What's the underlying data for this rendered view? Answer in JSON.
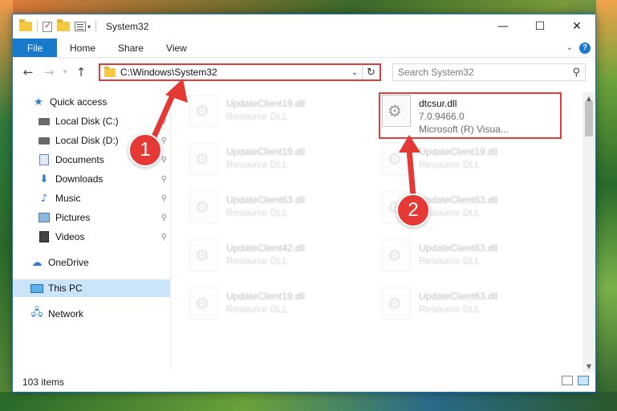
{
  "window": {
    "title": "System32",
    "controls": {
      "minimize": "—",
      "maximize": "☐",
      "close": "✕"
    }
  },
  "ribbon": {
    "tabs": [
      {
        "label": "File"
      },
      {
        "label": "Home"
      },
      {
        "label": "Share"
      },
      {
        "label": "View"
      }
    ]
  },
  "address": {
    "path": "C:\\Windows\\System32"
  },
  "search": {
    "placeholder": "Search System32"
  },
  "sidebar": {
    "items": [
      {
        "label": "Quick access",
        "icon": "star-icon"
      },
      {
        "label": "Local Disk (C:)",
        "icon": "drive-icon"
      },
      {
        "label": "Local Disk (D:)",
        "icon": "drive-icon"
      },
      {
        "label": "Documents",
        "icon": "documents-icon"
      },
      {
        "label": "Downloads",
        "icon": "download-icon"
      },
      {
        "label": "Music",
        "icon": "music-icon"
      },
      {
        "label": "Pictures",
        "icon": "pictures-icon"
      },
      {
        "label": "Videos",
        "icon": "videos-icon"
      },
      {
        "label": "OneDrive",
        "icon": "cloud-icon"
      },
      {
        "label": "This PC",
        "icon": "computer-icon"
      },
      {
        "label": "Network",
        "icon": "network-icon"
      }
    ]
  },
  "files": [
    {
      "name": "UpdateClient19.dll",
      "sub": "Resource DLL"
    },
    {
      "name": "dtcsur.dll",
      "sub": "7.0.9466.0",
      "sub2": "Microsoft (R) Visua..."
    },
    {
      "name": "UpdateClient19.dll",
      "sub": "Resource DLL"
    },
    {
      "name": "UpdateClient19.dll",
      "sub": "Resource DLL"
    },
    {
      "name": "UpdateClient63.dll",
      "sub": "Resource DLL"
    },
    {
      "name": "UpdateClient63.dll",
      "sub": "Resource DLL"
    },
    {
      "name": "UpdateClient42.dll",
      "sub": "Resource DLL"
    },
    {
      "name": "UpdateClient63.dll",
      "sub": "Resource DLL"
    },
    {
      "name": "UpdateClient19.dll",
      "sub": "Resource DLL"
    },
    {
      "name": "UpdateClient63.dll",
      "sub": "Resource DLL"
    }
  ],
  "status": {
    "item_count": "103 items"
  },
  "callouts": {
    "one": "1",
    "two": "2",
    "color": "#e53935"
  },
  "colors": {
    "accent": "#1979ca",
    "highlight": "#e03c3c",
    "selected": "#cce4f7"
  }
}
